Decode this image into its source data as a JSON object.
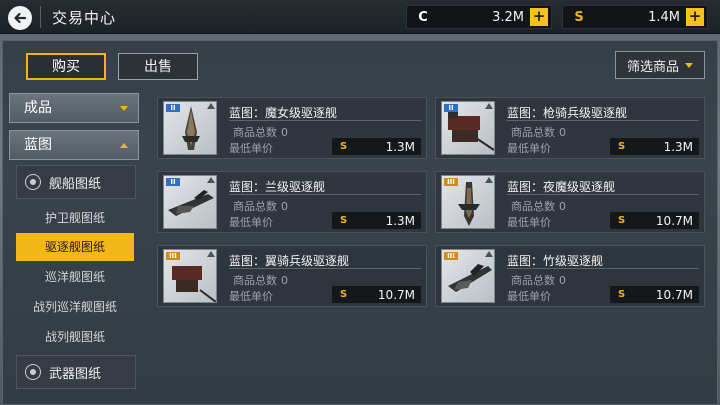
{
  "header": {
    "title": "交易中心"
  },
  "currencies": [
    {
      "symbol": "C",
      "value": "3.2M",
      "color": "#ffffff"
    },
    {
      "symbol": "S",
      "value": "1.4M",
      "color": "#f0b21f"
    }
  ],
  "tabs": {
    "buy": "购买",
    "sell": "出售"
  },
  "filter": {
    "label": "筛选商品"
  },
  "sidebar": {
    "categories": [
      "成品",
      "蓝图"
    ],
    "sub_categories": [
      "舰船图纸",
      "武器图纸"
    ],
    "leaves": [
      "护卫舰图纸",
      "驱逐舰图纸",
      "巡洋舰图纸",
      "战列巡洋舰图纸",
      "战列舰图纸"
    ],
    "active_leaf": "驱逐舰图纸"
  },
  "products": [
    {
      "name": "蓝图：魔女级驱逐舰",
      "total_label": "商品总数",
      "total": "0",
      "min_label": "最低单价",
      "currency": "S",
      "price": "1.3M",
      "tier": "II"
    },
    {
      "name": "蓝图：枪骑兵级驱逐舰",
      "total_label": "商品总数",
      "total": "0",
      "min_label": "最低单价",
      "currency": "S",
      "price": "1.3M",
      "tier": "II"
    },
    {
      "name": "蓝图：兰级驱逐舰",
      "total_label": "商品总数",
      "total": "0",
      "min_label": "最低单价",
      "currency": "S",
      "price": "1.3M",
      "tier": "II"
    },
    {
      "name": "蓝图：夜魔级驱逐舰",
      "total_label": "商品总数",
      "total": "0",
      "min_label": "最低单价",
      "currency": "S",
      "price": "10.7M",
      "tier": "III"
    },
    {
      "name": "蓝图：翼骑兵级驱逐舰",
      "total_label": "商品总数",
      "total": "0",
      "min_label": "最低单价",
      "currency": "S",
      "price": "10.7M",
      "tier": "III"
    },
    {
      "name": "蓝图：竹级驱逐舰",
      "total_label": "商品总数",
      "total": "0",
      "min_label": "最低单价",
      "currency": "S",
      "price": "10.7M",
      "tier": "III"
    }
  ]
}
